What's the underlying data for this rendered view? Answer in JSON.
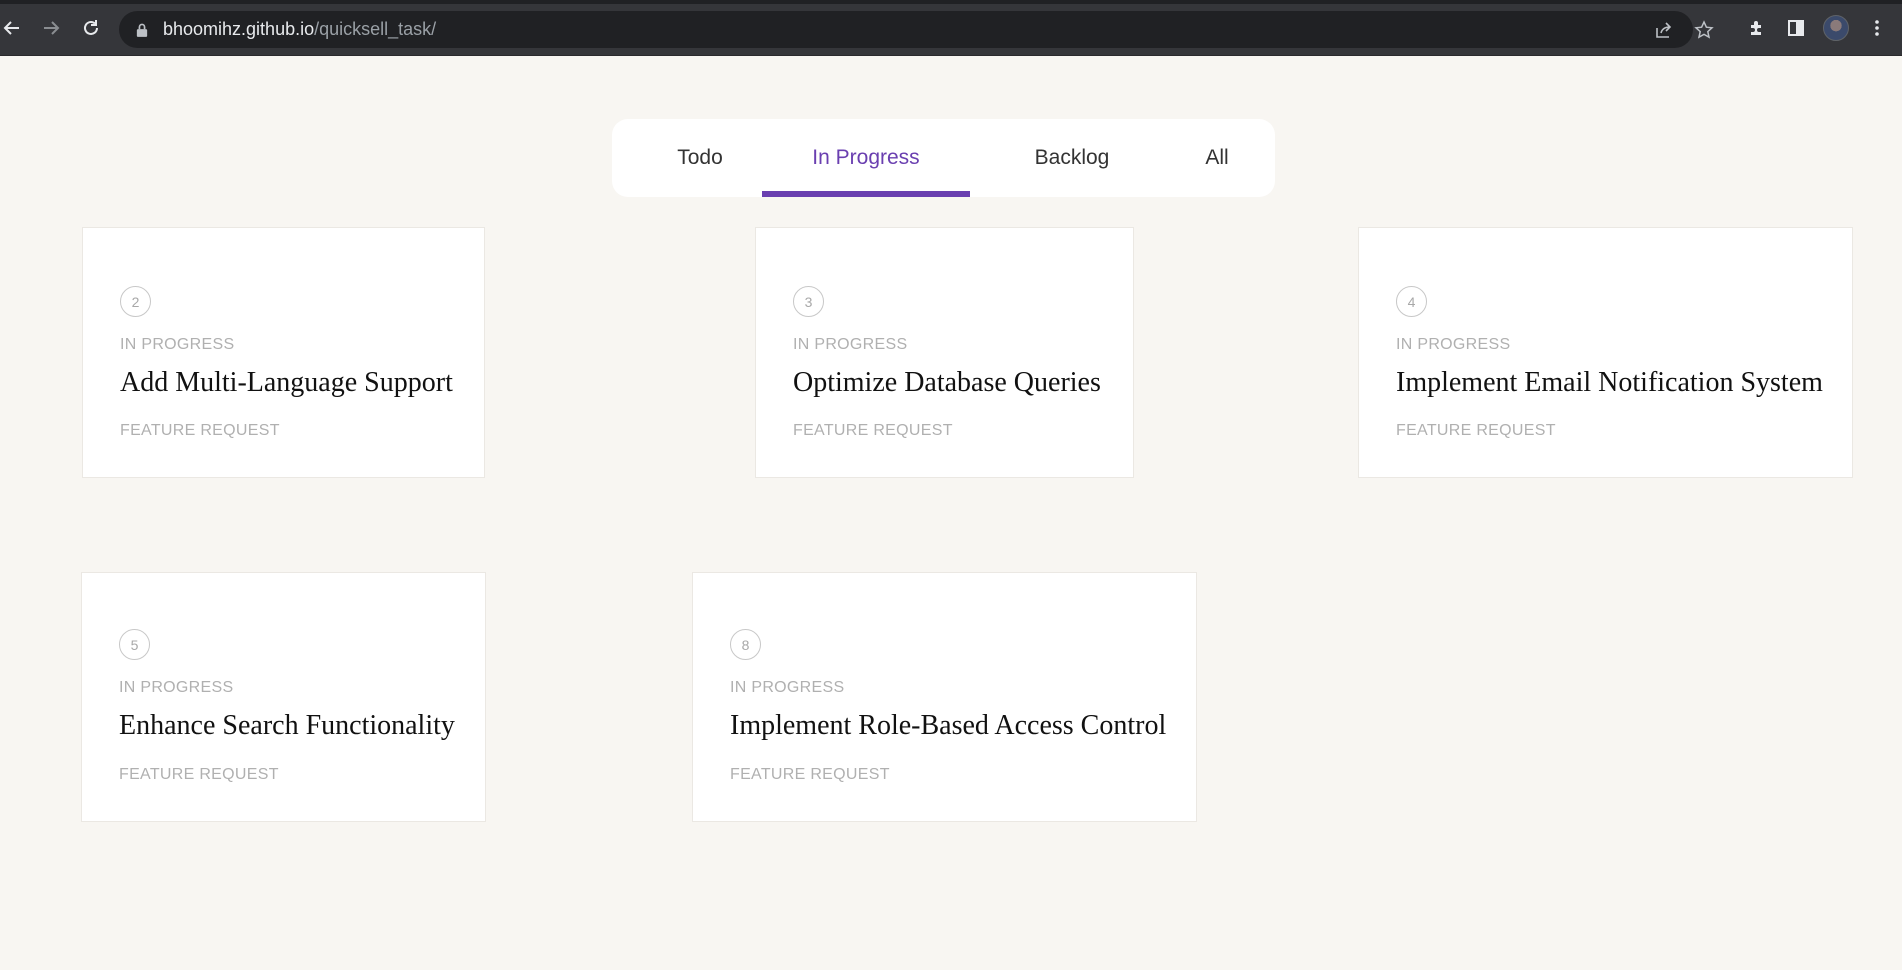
{
  "browser": {
    "url_host": "bhoomihz.github.io",
    "url_path": "/quicksell_task/"
  },
  "tabs": [
    {
      "label": "Todo",
      "active": false
    },
    {
      "label": "In Progress",
      "active": true
    },
    {
      "label": "Backlog",
      "active": false
    },
    {
      "label": "All",
      "active": false
    }
  ],
  "accent_color": "#6a3fb0",
  "cards": [
    {
      "number": "2",
      "status": "IN PROGRESS",
      "title": "Add Multi-Language Support",
      "category": "FEATURE REQUEST"
    },
    {
      "number": "3",
      "status": "IN PROGRESS",
      "title": "Optimize Database Queries",
      "category": "FEATURE REQUEST"
    },
    {
      "number": "4",
      "status": "IN PROGRESS",
      "title": "Implement Email Notification System",
      "category": "FEATURE REQUEST"
    },
    {
      "number": "5",
      "status": "IN PROGRESS",
      "title": "Enhance Search Functionality",
      "category": "FEATURE REQUEST"
    },
    {
      "number": "8",
      "status": "IN PROGRESS",
      "title": "Implement Role-Based Access Control",
      "category": "FEATURE REQUEST"
    }
  ]
}
